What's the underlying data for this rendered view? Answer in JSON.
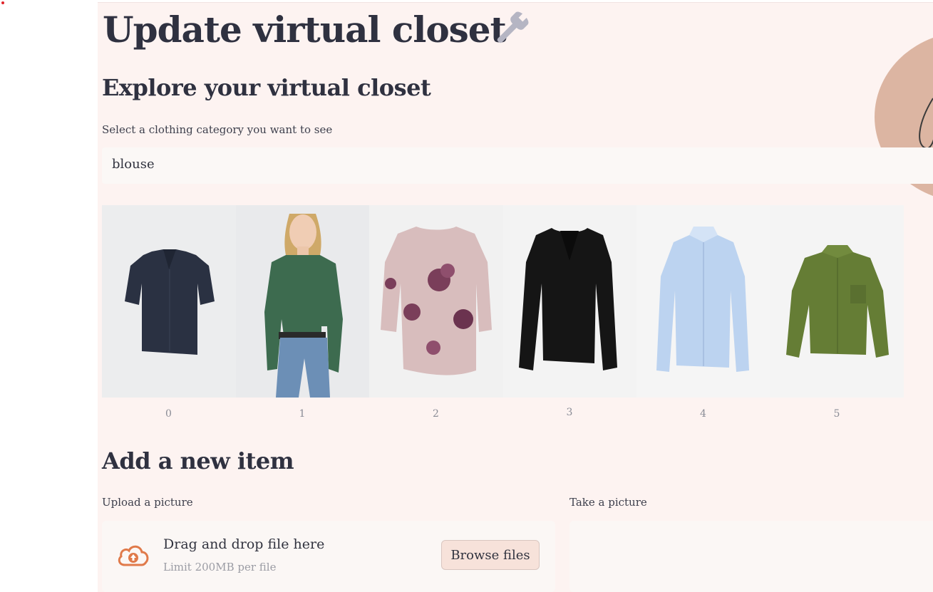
{
  "page": {
    "title": "Update virtual closet",
    "title_icon": "wrench-icon"
  },
  "explore": {
    "heading": "Explore your virtual closet",
    "select_label": "Select a clothing category you want to see",
    "selected_category": "blouse"
  },
  "gallery": {
    "items": [
      {
        "caption": "0",
        "description": "navy short-sleeve blouse"
      },
      {
        "caption": "1",
        "description": "model in green blouse and jeans"
      },
      {
        "caption": "2",
        "description": "pink floral long-sleeve top"
      },
      {
        "caption": "3",
        "description": "black long-sleeve blouse"
      },
      {
        "caption": "4",
        "description": "light blue button shirt"
      },
      {
        "caption": "5",
        "description": "olive green shirt"
      }
    ]
  },
  "add_item": {
    "heading": "Add a new item",
    "upload_label": "Upload a picture",
    "dropzone_title": "Drag and drop file here",
    "dropzone_limit": "Limit 200MB per file",
    "browse_button": "Browse files",
    "upload_icon": "cloud-upload-icon",
    "camera_label": "Take a picture"
  },
  "colors": {
    "app_background": "#fdf3f1",
    "accent": "#e07a4a",
    "button_background": "#f7e2da"
  }
}
